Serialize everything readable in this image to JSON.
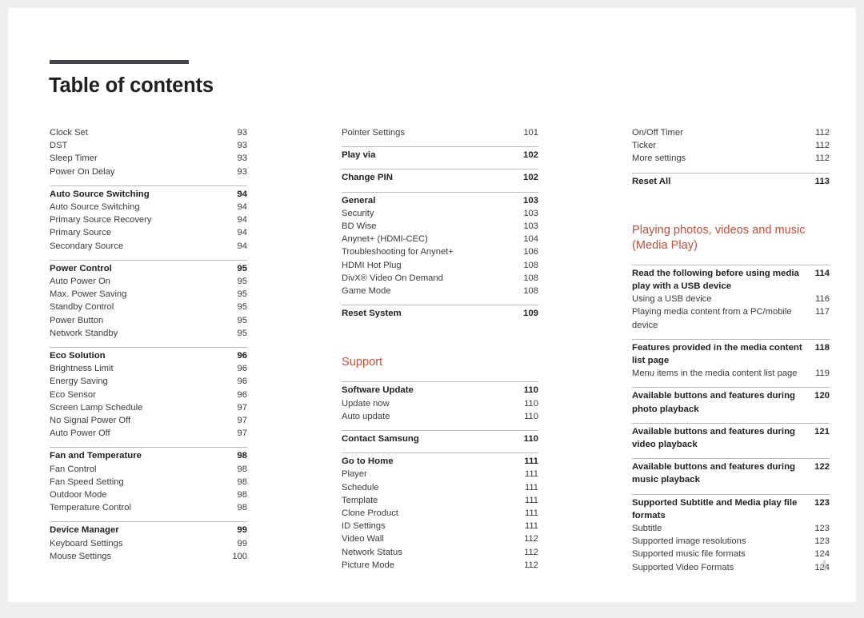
{
  "document": {
    "title": "Table of contents",
    "folio": "4",
    "accent_color": "#c0513b",
    "rule_color": "#bcbcbc",
    "title_rule_color": "#45454f",
    "text_color": "#3b3b40",
    "folio_color": "#c5cdd0"
  },
  "columns": [
    {
      "blocks": [
        {
          "type": "entries",
          "rule_above": false,
          "items": [
            {
              "label": "Clock Set",
              "page": "93",
              "bold": false
            },
            {
              "label": "DST",
              "page": "93",
              "bold": false
            },
            {
              "label": "Sleep Timer",
              "page": "93",
              "bold": false
            },
            {
              "label": "Power On Delay",
              "page": "93",
              "bold": false
            }
          ]
        },
        {
          "type": "entries",
          "rule_above": true,
          "items": [
            {
              "label": "Auto Source Switching",
              "page": "94",
              "bold": true
            },
            {
              "label": "Auto Source Switching",
              "page": "94",
              "bold": false
            },
            {
              "label": "Primary Source Recovery",
              "page": "94",
              "bold": false
            },
            {
              "label": "Primary Source",
              "page": "94",
              "bold": false
            },
            {
              "label": "Secondary Source",
              "page": "94",
              "bold": false
            }
          ]
        },
        {
          "type": "entries",
          "rule_above": true,
          "items": [
            {
              "label": "Power Control",
              "page": "95",
              "bold": true
            },
            {
              "label": "Auto Power On",
              "page": "95",
              "bold": false
            },
            {
              "label": "Max. Power Saving",
              "page": "95",
              "bold": false
            },
            {
              "label": "Standby Control",
              "page": "95",
              "bold": false
            },
            {
              "label": "Power Button",
              "page": "95",
              "bold": false
            },
            {
              "label": "Network Standby",
              "page": "95",
              "bold": false
            }
          ]
        },
        {
          "type": "entries",
          "rule_above": true,
          "items": [
            {
              "label": "Eco Solution",
              "page": "96",
              "bold": true
            },
            {
              "label": "Brightness Limit",
              "page": "96",
              "bold": false
            },
            {
              "label": "Energy Saving",
              "page": "96",
              "bold": false
            },
            {
              "label": "Eco Sensor",
              "page": "96",
              "bold": false
            },
            {
              "label": "Screen Lamp Schedule",
              "page": "97",
              "bold": false
            },
            {
              "label": "No Signal Power Off",
              "page": "97",
              "bold": false
            },
            {
              "label": "Auto Power Off",
              "page": "97",
              "bold": false
            }
          ]
        },
        {
          "type": "entries",
          "rule_above": true,
          "items": [
            {
              "label": "Fan and Temperature",
              "page": "98",
              "bold": true
            },
            {
              "label": "Fan Control",
              "page": "98",
              "bold": false
            },
            {
              "label": "Fan Speed Setting",
              "page": "98",
              "bold": false
            },
            {
              "label": "Outdoor Mode",
              "page": "98",
              "bold": false
            },
            {
              "label": "Temperature Control",
              "page": "98",
              "bold": false
            }
          ]
        },
        {
          "type": "entries",
          "rule_above": true,
          "items": [
            {
              "label": "Device Manager",
              "page": "99",
              "bold": true
            },
            {
              "label": "Keyboard Settings",
              "page": "99",
              "bold": false
            },
            {
              "label": "Mouse Settings",
              "page": "100",
              "bold": false
            }
          ]
        }
      ]
    },
    {
      "blocks": [
        {
          "type": "entries",
          "rule_above": false,
          "items": [
            {
              "label": "Pointer Settings",
              "page": "101",
              "bold": false
            }
          ]
        },
        {
          "type": "entries",
          "rule_above": true,
          "items": [
            {
              "label": "Play via",
              "page": "102",
              "bold": true
            }
          ]
        },
        {
          "type": "entries",
          "rule_above": true,
          "items": [
            {
              "label": "Change PIN",
              "page": "102",
              "bold": true
            }
          ]
        },
        {
          "type": "entries",
          "rule_above": true,
          "items": [
            {
              "label": "General",
              "page": "103",
              "bold": true
            },
            {
              "label": "Security",
              "page": "103",
              "bold": false
            },
            {
              "label": "BD Wise",
              "page": "103",
              "bold": false
            },
            {
              "label": "Anynet+ (HDMI-CEC)",
              "page": "104",
              "bold": false
            },
            {
              "label": "Troubleshooting for Anynet+",
              "page": "106",
              "bold": false
            },
            {
              "label": "HDMI Hot Plug",
              "page": "108",
              "bold": false
            },
            {
              "label": "DivX® Video On Demand",
              "page": "108",
              "bold": false
            },
            {
              "label": "Game Mode",
              "page": "108",
              "bold": false
            }
          ]
        },
        {
          "type": "entries",
          "rule_above": true,
          "items": [
            {
              "label": "Reset System",
              "page": "109",
              "bold": true
            }
          ]
        },
        {
          "type": "chapter",
          "label": "Support"
        },
        {
          "type": "entries",
          "rule_above": true,
          "items": [
            {
              "label": "Software Update",
              "page": "110",
              "bold": true
            },
            {
              "label": "Update now",
              "page": "110",
              "bold": false
            },
            {
              "label": "Auto update",
              "page": "110",
              "bold": false
            }
          ]
        },
        {
          "type": "entries",
          "rule_above": true,
          "items": [
            {
              "label": "Contact Samsung",
              "page": "110",
              "bold": true
            }
          ]
        },
        {
          "type": "entries",
          "rule_above": true,
          "items": [
            {
              "label": "Go to Home",
              "page": "111",
              "bold": true
            },
            {
              "label": "Player",
              "page": "111",
              "bold": false
            },
            {
              "label": "Schedule",
              "page": "111",
              "bold": false
            },
            {
              "label": "Template",
              "page": "111",
              "bold": false
            },
            {
              "label": "Clone Product",
              "page": "111",
              "bold": false
            },
            {
              "label": "ID Settings",
              "page": "111",
              "bold": false
            },
            {
              "label": "Video Wall",
              "page": "112",
              "bold": false
            },
            {
              "label": "Network Status",
              "page": "112",
              "bold": false
            },
            {
              "label": "Picture Mode",
              "page": "112",
              "bold": false
            }
          ]
        }
      ]
    },
    {
      "blocks": [
        {
          "type": "entries",
          "rule_above": false,
          "items": [
            {
              "label": "On/Off Timer",
              "page": "112",
              "bold": false
            },
            {
              "label": "Ticker",
              "page": "112",
              "bold": false
            },
            {
              "label": "More settings",
              "page": "112",
              "bold": false
            }
          ]
        },
        {
          "type": "entries",
          "rule_above": true,
          "items": [
            {
              "label": "Reset All",
              "page": "113",
              "bold": true
            }
          ]
        },
        {
          "type": "chapter",
          "label": "Playing photos, videos and music (Media Play)"
        },
        {
          "type": "entries",
          "rule_above": true,
          "items": [
            {
              "label": "Read the following before using media play with a USB device",
              "page": "114",
              "bold": true,
              "multiline": true
            },
            {
              "label": "Using a USB device",
              "page": "116",
              "bold": false
            },
            {
              "label": "Playing media content from a PC/mobile device",
              "page": "117",
              "bold": false,
              "tight": true
            }
          ]
        },
        {
          "type": "entries",
          "rule_above": true,
          "items": [
            {
              "label": "Features provided in the media content list page",
              "page": "118",
              "bold": true,
              "multiline": true
            },
            {
              "label": "Menu items in the media content list page",
              "page": "119",
              "bold": false
            }
          ]
        },
        {
          "type": "entries",
          "rule_above": true,
          "items": [
            {
              "label": "Available buttons and features during photo playback",
              "page": "120",
              "bold": true,
              "multiline": true
            }
          ]
        },
        {
          "type": "entries",
          "rule_above": true,
          "items": [
            {
              "label": "Available buttons and features during video playback",
              "page": "121",
              "bold": true,
              "multiline": true
            }
          ]
        },
        {
          "type": "entries",
          "rule_above": true,
          "items": [
            {
              "label": "Available buttons and features during music playback",
              "page": "122",
              "bold": true,
              "multiline": true
            }
          ]
        },
        {
          "type": "entries",
          "rule_above": true,
          "items": [
            {
              "label": "Supported Subtitle and Media play file formats",
              "page": "123",
              "bold": true,
              "multiline": true
            },
            {
              "label": "Subtitle",
              "page": "123",
              "bold": false
            },
            {
              "label": "Supported image resolutions",
              "page": "123",
              "bold": false
            },
            {
              "label": "Supported music file formats",
              "page": "124",
              "bold": false
            },
            {
              "label": "Supported Video Formats",
              "page": "124",
              "bold": false
            }
          ]
        }
      ]
    }
  ]
}
